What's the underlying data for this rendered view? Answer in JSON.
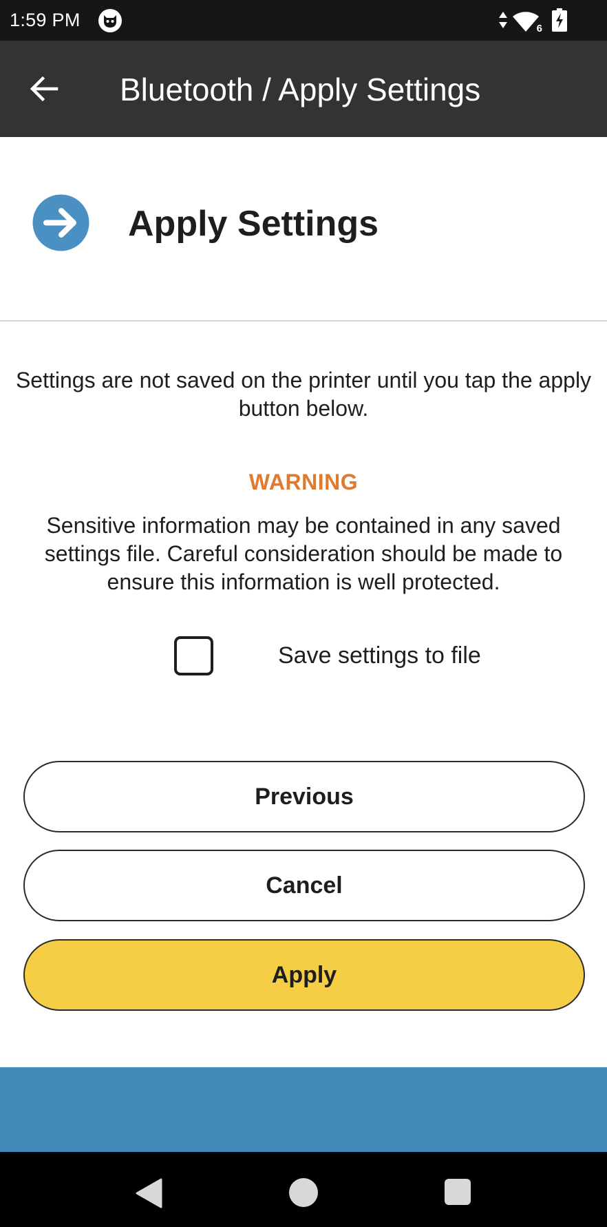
{
  "status_bar": {
    "time": "1:59 PM",
    "network_label": "6",
    "icons": [
      "cat-icon",
      "data-arrows-icon",
      "wifi-icon",
      "battery-charging-icon"
    ]
  },
  "app_bar": {
    "title": "Bluetooth / Apply Settings",
    "back_icon": "arrow-left-icon"
  },
  "section": {
    "title": "Apply Settings",
    "icon": "arrow-right-circle-icon",
    "icon_color": "#4a90c2"
  },
  "content": {
    "intro": "Settings are not saved on the printer until you tap the apply button below.",
    "warning_title": "WARNING",
    "warning_text": "Sensitive information may be contained in any saved settings file. Careful consideration should be made to ensure this information is well protected.",
    "warning_color": "#e07a2e"
  },
  "checkbox": {
    "label": "Save settings to file",
    "checked": false
  },
  "buttons": {
    "previous": "Previous",
    "cancel": "Cancel",
    "apply": "Apply",
    "apply_color": "#f6ce45"
  },
  "colors": {
    "status_bar": "#161616",
    "app_bar": "#333333",
    "footer_band": "#4389b9",
    "nav_bar": "#000000"
  },
  "nav_bar": {
    "icons": [
      "nav-back-icon",
      "nav-home-icon",
      "nav-recents-icon"
    ]
  }
}
